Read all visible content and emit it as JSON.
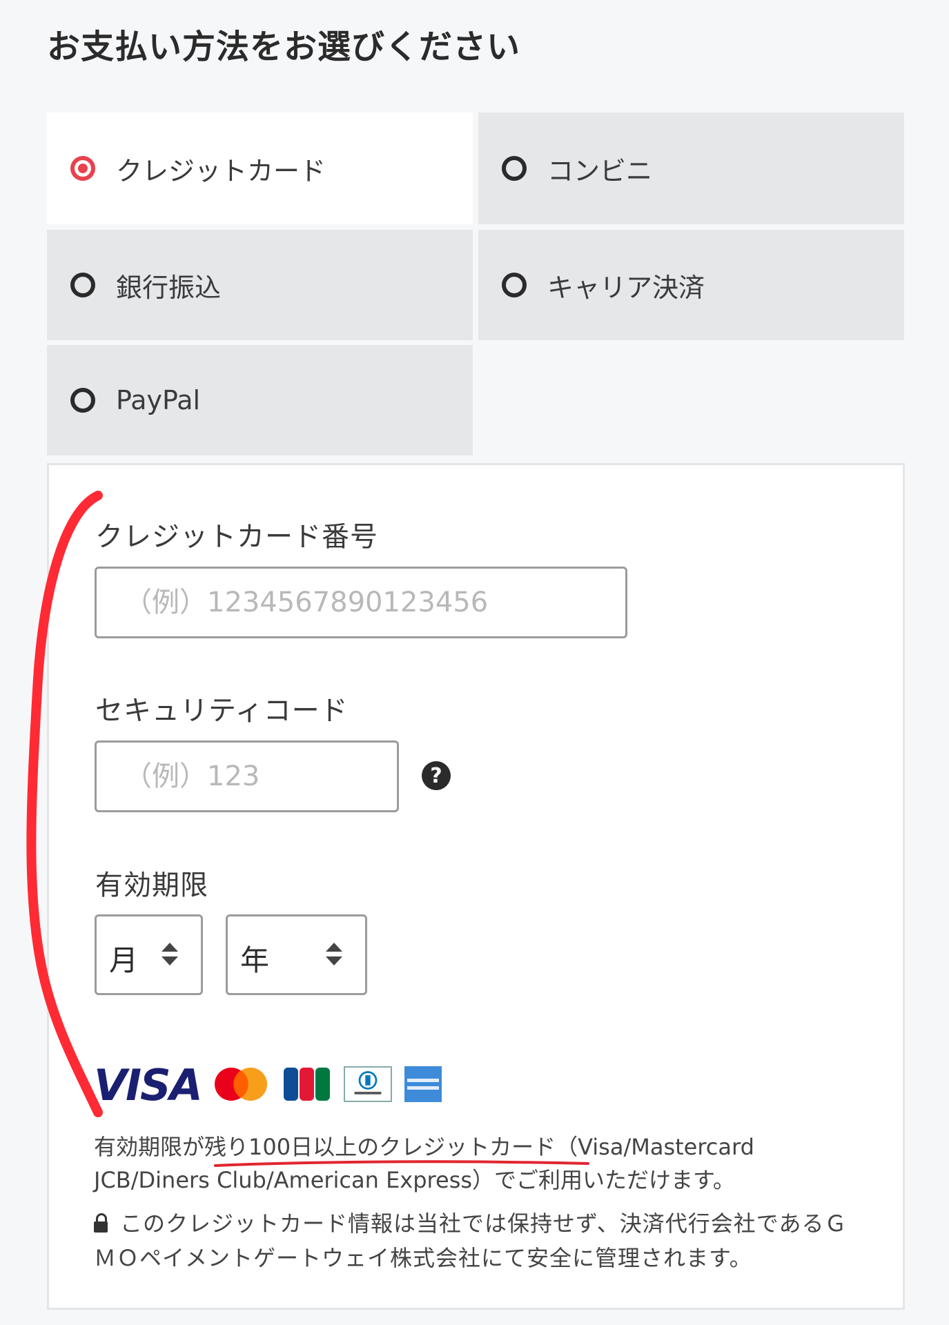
{
  "header": {
    "title": "お支払い方法をお選びください"
  },
  "payment_methods": [
    {
      "label": "クレジットカード",
      "selected": true
    },
    {
      "label": "コンビニ",
      "selected": false
    },
    {
      "label": "銀行振込",
      "selected": false
    },
    {
      "label": "キャリア決済",
      "selected": false
    },
    {
      "label": "PayPal",
      "selected": false
    }
  ],
  "card_form": {
    "card_number_label": "クレジットカード番号",
    "card_number_placeholder": "（例）1234567890123456",
    "security_code_label": "セキュリティコード",
    "security_code_placeholder": "（例）123",
    "help_icon": "?",
    "expiry_label": "有効期限",
    "month_value": "月",
    "year_value": "年"
  },
  "card_brands": [
    "VISA",
    "MasterCard",
    "JCB",
    "Diners Club",
    "American Express"
  ],
  "notes": {
    "accepted_cards": "有効期限が残り100日以上のクレジットカード（Visa/Mastercard JCB/Diners Club/American Express）でご利用いただけます。",
    "security": "このクレジットカード情報は当社では保持せず、決済代行会社であるＧＭＯペイメントゲートウェイ株式会社にて安全に管理されます。"
  },
  "colors": {
    "accent": "#e8424e",
    "annotation": "#ff2a33"
  }
}
